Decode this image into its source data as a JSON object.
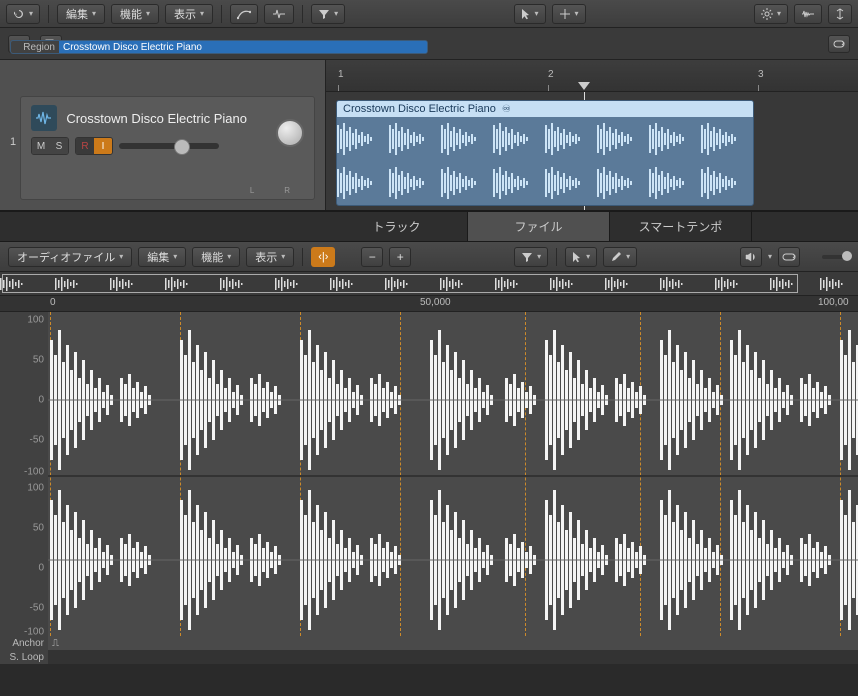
{
  "toolbar_top": {
    "back_icon": "undo-curve",
    "menus": {
      "edit": "編集",
      "func": "機能",
      "view": "表示"
    },
    "tool_icons": [
      "automation-curve",
      "flex",
      "filter"
    ],
    "right_tools": [
      "pointer",
      "marquee"
    ],
    "far_right": [
      "gear",
      "zoom-vert",
      "fit-vert"
    ]
  },
  "track_header_row": {
    "add": "+",
    "catalog": "⊞",
    "loop": "↻"
  },
  "ruler": {
    "m1": "1",
    "m2": "2",
    "m3": "3"
  },
  "track": {
    "number": "1",
    "name": "Crosstown Disco Electric Piano",
    "buttons": {
      "m": "M",
      "s": "S",
      "r": "R",
      "i": "I"
    },
    "lr": "L R"
  },
  "region": {
    "name": "Crosstown Disco Electric Piano",
    "loop_glyph": "♾"
  },
  "editor_tabs": {
    "track": "トラック",
    "file": "ファイル",
    "smart": "スマートテンポ"
  },
  "editor_toolbar": {
    "menus": {
      "audiofile": "オーディオファイル",
      "edit": "編集",
      "func": "機能",
      "view": "表示"
    },
    "split": "‹|›",
    "minus": "−",
    "plus": "+",
    "right_tools": [
      "filter",
      "pointer",
      "pencil"
    ],
    "far_right": [
      "speaker",
      "cycle"
    ]
  },
  "sample_ruler": {
    "zero": "0",
    "mid": "50,000",
    "end": "100,00"
  },
  "amp_scale": [
    "100",
    "50",
    "0",
    "-50",
    "-100",
    "100",
    "50",
    "0",
    "-50",
    "-100"
  ],
  "info": {
    "anchor_label": "Anchor",
    "anchor_glyph": "⎍",
    "region_label": "Region",
    "region_value": "Crosstown Disco Electric Piano",
    "sloop_label": "S. Loop"
  }
}
